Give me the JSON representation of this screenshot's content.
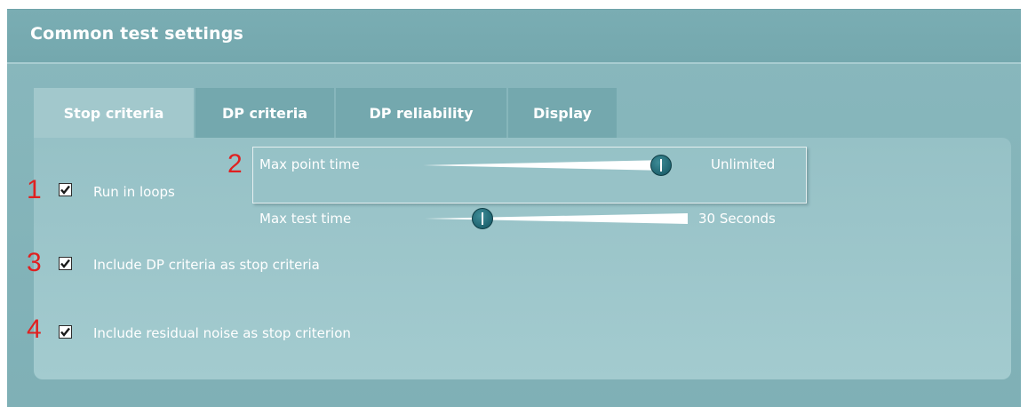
{
  "header": {
    "title": "Common test settings"
  },
  "tabs": [
    {
      "label": "Stop criteria",
      "active": true
    },
    {
      "label": "DP criteria",
      "active": false
    },
    {
      "label": "DP reliability",
      "active": false
    },
    {
      "label": "Display",
      "active": false
    }
  ],
  "annotations": [
    "1",
    "2",
    "3",
    "4"
  ],
  "options": {
    "run_in_loops": {
      "label": "Run in loops",
      "checked": true
    },
    "include_dp_criteria": {
      "label": "Include DP criteria as stop criteria",
      "checked": true
    },
    "include_residual_noise": {
      "label": "Include residual noise as stop criterion",
      "checked": true
    }
  },
  "sliders": {
    "max_point_time": {
      "label": "Max point time",
      "value": "Unlimited",
      "level": 0.97
    },
    "max_test_time": {
      "label": "Max test time",
      "value": "30 Seconds",
      "level": 0.22
    }
  },
  "colors": {
    "panel": "#7fb0b6",
    "content": "#a3cbcf",
    "annotation": "#e02020",
    "knob": "#1f6470"
  }
}
